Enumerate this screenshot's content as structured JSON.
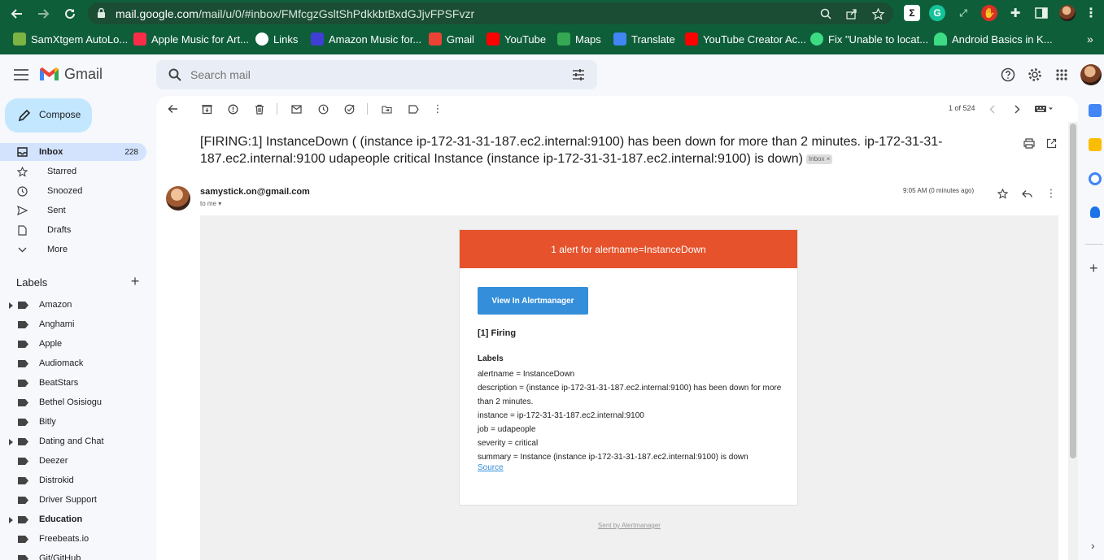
{
  "browser": {
    "url_host": "mail.google.com",
    "url_path": "/mail/u/0/#inbox/FMfcgzGsltShPdkkbtBxdGJjvFPSFvzr",
    "bookmarks": [
      "SamXtgem AutoLo...",
      "Apple Music for Art...",
      "Links",
      "Amazon Music for...",
      "Gmail",
      "YouTube",
      "Maps",
      "Translate",
      "YouTube Creator Ac...",
      "Fix \"Unable to locat...",
      "Android Basics in K..."
    ],
    "more_bookmarks": "»"
  },
  "gmail": {
    "logo_text": "Gmail",
    "search_placeholder": "Search mail",
    "compose_label": "Compose",
    "nav": [
      {
        "label": "Inbox",
        "count": "228"
      },
      {
        "label": "Starred"
      },
      {
        "label": "Snoozed"
      },
      {
        "label": "Sent"
      },
      {
        "label": "Drafts"
      },
      {
        "label": "More"
      }
    ],
    "labels_heading": "Labels",
    "labels": [
      "Amazon",
      "Anghami",
      "Apple",
      "Audiomack",
      "BeatStars",
      "Bethel Osisiogu",
      "Bitly",
      "Dating and Chat",
      "Deezer",
      "Distrokid",
      "Driver Support",
      "Education",
      "Freebeats.io",
      "Git/GitHub"
    ],
    "pager": "1 of 524"
  },
  "message": {
    "subject": "[FIRING:1] InstanceDown ( (instance ip-172-31-31-187.ec2.internal:9100) has been down for more than 2 minutes. ip-172-31-31-187.ec2.internal:9100 udapeople critical Instance (instance ip-172-31-31-187.ec2.internal:9100) is down)",
    "inbox_chip": "Inbox ×",
    "sender": "samystick.on@gmail.com",
    "to": "to me",
    "time": "9:05 AM (0 minutes ago)",
    "alert_header": "1 alert for alertname=InstanceDown",
    "button_label": "View In Alertmanager",
    "firing": "[1] Firing",
    "labels_title": "Labels",
    "label_lines": [
      "alertname = InstanceDown",
      "description = (instance ip-172-31-31-187.ec2.internal:9100) has been down for more than 2 minutes.",
      "instance = ip-172-31-31-187.ec2.internal:9100",
      "job = udapeople",
      "severity = critical",
      "summary = Instance (instance ip-172-31-31-187.ec2.internal:9100) is down"
    ],
    "source_link": "Source",
    "footer": "Sent by Alertmanager"
  },
  "colors": {
    "chrome_bg": "#0e5e3a",
    "compose_bg": "#c2e7ff",
    "active_nav": "#d3e3fd",
    "alert_header": "#e6522c",
    "alert_button": "#348eda"
  }
}
